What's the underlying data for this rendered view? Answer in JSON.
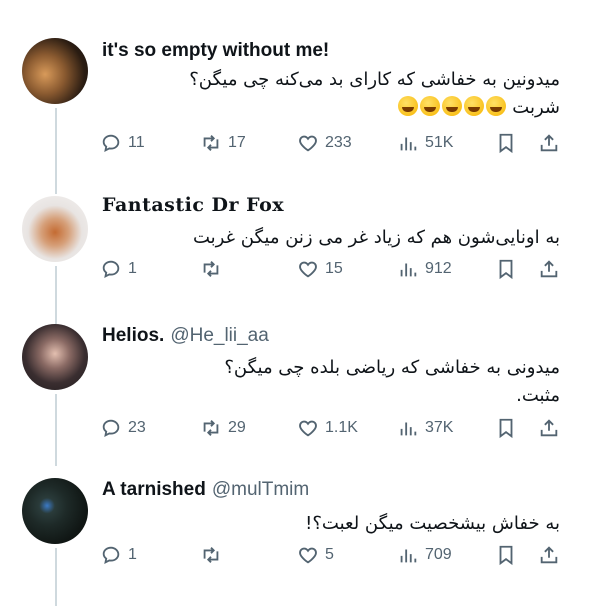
{
  "tweets": [
    {
      "name": "it's so empty without me!",
      "handle": "",
      "text": "میدونین به خفاشی که کارای بد می‌کنه چی میگن؟",
      "text2": "شربت",
      "emoji_count": 5,
      "emoji": "rolling-on-floor-laughing",
      "stats": {
        "replies": "11",
        "retweets": "17",
        "likes": "233",
        "views": "51K"
      }
    },
    {
      "name": "Fantastic Dr Fox",
      "handle": "",
      "text": "به اونایی‌شون هم که زیاد غر می زنن میگن غربت",
      "stats": {
        "replies": "1",
        "retweets": "",
        "likes": "15",
        "views": "912"
      }
    },
    {
      "name": "Helios.",
      "handle": "@He_lii_aa",
      "text": "میدونی به خفاشی که ریاضی بلده چی میگن؟",
      "text2": "مثبت.",
      "stats": {
        "replies": "23",
        "retweets": "29",
        "likes": "1.1K",
        "views": "37K"
      }
    },
    {
      "name": "A tarnished",
      "handle": "@mulTmim",
      "text": "به خفاش بیشخصیت میگن لعبت؟!",
      "stats": {
        "replies": "1",
        "retweets": "",
        "likes": "5",
        "views": "709"
      }
    }
  ],
  "icons": {
    "reply": "reply-icon",
    "retweet": "retweet-icon",
    "like": "heart-icon",
    "views": "views-icon",
    "bookmark": "bookmark-icon",
    "share": "share-icon"
  },
  "colors": {
    "muted": "#536471",
    "thread_line": "#cfd9de",
    "text": "#0f1419"
  }
}
